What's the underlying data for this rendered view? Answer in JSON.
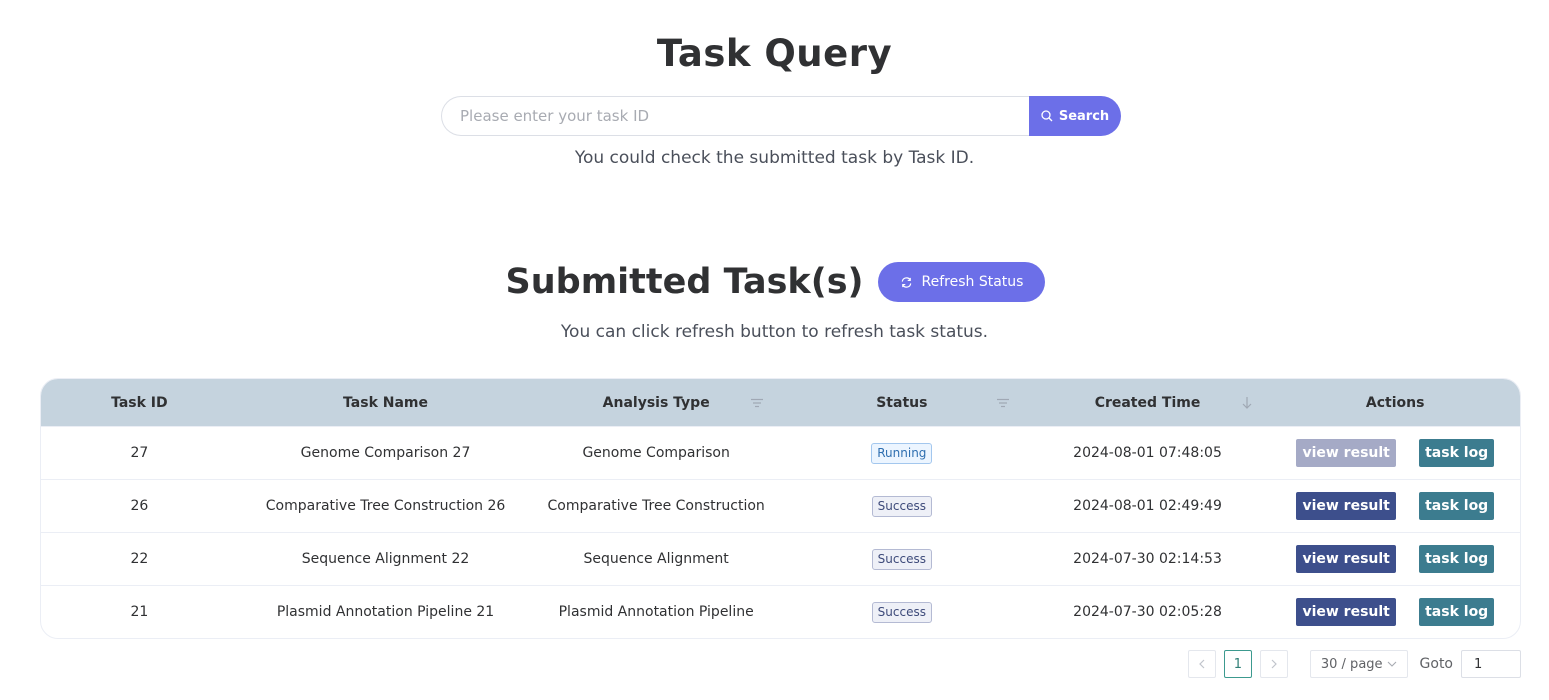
{
  "task_query": {
    "title": "Task Query",
    "search_placeholder": "Please enter your task ID",
    "search_value": "",
    "search_button": "Search",
    "hint": "You could check the submitted task by Task ID."
  },
  "submitted": {
    "title": "Submitted Task(s)",
    "refresh_button": "Refresh Status",
    "hint": "You can click refresh button to refresh task status."
  },
  "table": {
    "columns": [
      "Task ID",
      "Task Name",
      "Analysis Type",
      "Status",
      "Created Time",
      "Actions"
    ],
    "rows": [
      {
        "id": "27",
        "name": "Genome Comparison 27",
        "type": "Genome Comparison",
        "status": "Running",
        "created": "2024-08-01 07:48:05",
        "view": "view result",
        "log": "task log"
      },
      {
        "id": "26",
        "name": "Comparative Tree Construction 26",
        "type": "Comparative Tree Construction",
        "status": "Success",
        "created": "2024-08-01 02:49:49",
        "view": "view result",
        "log": "task log"
      },
      {
        "id": "22",
        "name": "Sequence Alignment 22",
        "type": "Sequence Alignment",
        "status": "Success",
        "created": "2024-07-30 02:14:53",
        "view": "view result",
        "log": "task log"
      },
      {
        "id": "21",
        "name": "Plasmid Annotation Pipeline 21",
        "type": "Plasmid Annotation Pipeline",
        "status": "Success",
        "created": "2024-07-30 02:05:28",
        "view": "view result",
        "log": "task log"
      }
    ]
  },
  "pagination": {
    "current_page": "1",
    "page_size": "30 / page",
    "goto_label": "Goto",
    "goto_value": "1"
  },
  "colors": {
    "primary": "#6c6fe8",
    "header_bg": "#c5d3de",
    "view_button": "#3d4f8c",
    "log_button": "#3c7c8f"
  }
}
